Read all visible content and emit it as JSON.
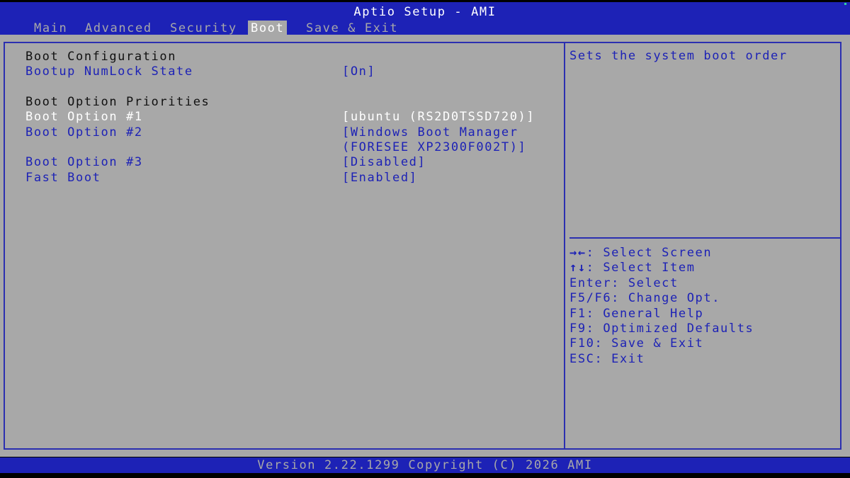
{
  "header": {
    "title": "Aptio Setup - AMI",
    "tabs": [
      {
        "label": "Main",
        "active": false
      },
      {
        "label": "Advanced",
        "active": false
      },
      {
        "label": "Security",
        "active": false
      },
      {
        "label": "Boot",
        "active": true
      },
      {
        "label": "Save & Exit",
        "active": false
      }
    ]
  },
  "main": {
    "boot_configuration_heading": "Boot Configuration",
    "numlock": {
      "label": "Bootup NumLock State",
      "value": "[On]"
    },
    "priorities_heading": "Boot Option Priorities",
    "option1": {
      "label": "Boot Option #1",
      "value": "[ubuntu (RS2D0TSSD720)]",
      "selected": true
    },
    "option2": {
      "label": "Boot Option #2",
      "value_line1": "[Windows Boot Manager",
      "value_line2": "(FORESEE XP2300F002T)]"
    },
    "option3": {
      "label": "Boot Option #3",
      "value": "[Disabled]"
    },
    "fast_boot": {
      "label": "Fast Boot",
      "value": "[Enabled]"
    }
  },
  "help": {
    "description": "Sets the system boot order",
    "keys": [
      {
        "icon": "→←",
        "icon_name": "left-right-arrows-icon",
        "text": ": Select Screen"
      },
      {
        "icon": "↑↓",
        "icon_name": "up-down-arrows-icon",
        "text": ": Select Item"
      },
      {
        "icon": "",
        "icon_name": "",
        "text": "Enter: Select"
      },
      {
        "icon": "",
        "icon_name": "",
        "text": "F5/F6: Change Opt."
      },
      {
        "icon": "",
        "icon_name": "",
        "text": "F1: General Help"
      },
      {
        "icon": "",
        "icon_name": "",
        "text": "F9: Optimized Defaults"
      },
      {
        "icon": "",
        "icon_name": "",
        "text": "F10: Save & Exit"
      },
      {
        "icon": "",
        "icon_name": "",
        "text": "ESC: Exit"
      }
    ]
  },
  "footer": {
    "version": "Version 2.22.1299 Copyright (C) 2026 AMI"
  },
  "colors": {
    "bios_blue": "#1d22b6",
    "panel_gray": "#a8a8a8",
    "frame_blue": "#2b2fb0",
    "selected_text": "#ffffff",
    "heading_text": "#111111"
  }
}
